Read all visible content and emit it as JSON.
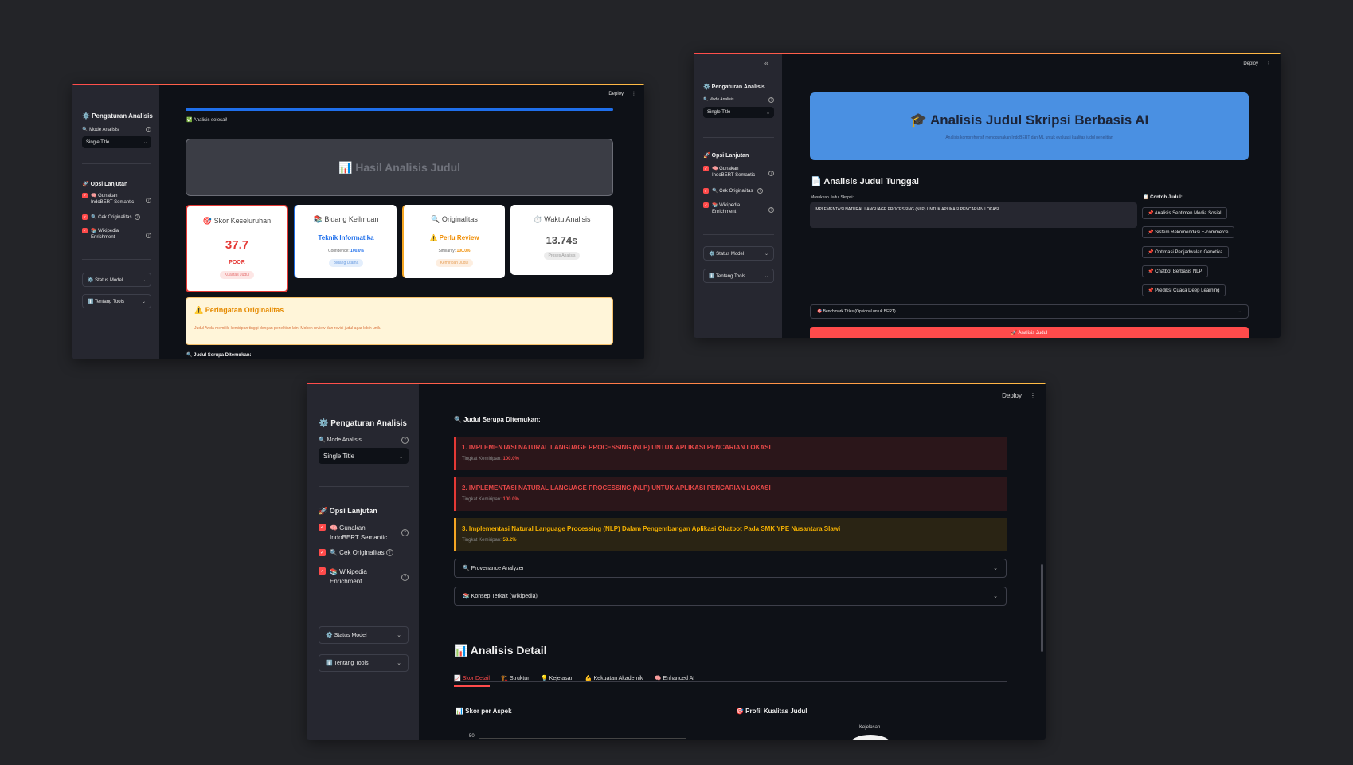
{
  "sidebar": {
    "settings_title": "⚙️ Pengaturan Analisis",
    "mode_label": "🔍 Mode Analisis",
    "mode_value": "Single Title",
    "options_title": "🚀 Opsi Lanjutan",
    "opt_indobert": "🧠 Gunakan IndoBERT Semantic",
    "opt_originality": "🔍 Cek Originalitas",
    "opt_wikipedia": "📚 Wikipedia Enrichment",
    "status_model": "⚙️ Status Model",
    "about_tools": "ℹ️ Tentang Tools",
    "help_symbol": "?"
  },
  "topbar": {
    "deploy": "Deploy",
    "menu": "⋮"
  },
  "window1": {
    "progress": 1.0,
    "done_text": "✅ Analisis selesai!",
    "result_title": "📊 Hasil Analisis Judul",
    "cards": {
      "score": {
        "title": "🎯 Skor Keseluruhan",
        "value": "37.7",
        "grade": "POOR",
        "tag": "Kualitas Judul"
      },
      "field": {
        "title": "📚 Bidang Keilmuan",
        "value": "Teknik Informatika",
        "conf_label": "Confidence:",
        "conf_value": "100.0%",
        "tag": "Bidang Utama"
      },
      "orig": {
        "title": "🔍 Originalitas",
        "value": "⚠️ Perlu Review",
        "sim_label": "Similarity:",
        "sim_value": "100.0%",
        "tag": "Kemiripan Judul"
      },
      "time": {
        "title": "⏱️ Waktu Analisis",
        "value": "13.74s",
        "tag": "Proses Analisis"
      }
    },
    "warning_title": "⚠️ Peringatan Originalitas",
    "warning_text": "Judul Anda memiliki kemiripan tinggi dengan penelitian lain. Mohon review dan revisi judul agar lebih unik.",
    "similar_title": "🔍 Judul Serupa Ditemukan:"
  },
  "window2": {
    "collapse": "«",
    "hero_title": "🎓 Analisis Judul Skripsi Berbasis AI",
    "hero_sub": "Analisis komprehensif menggunakan IndoBERT dan ML untuk evaluasi kualitas judul penelitian",
    "single_title": "📄 Analisis Judul Tunggal",
    "input_label": "Masukkan Judul Skripsi:",
    "input_value": "IMPLEMENTASI NATURAL LANGUAGE PROCESSING (NLP) UNTUK APLIKASI PENCARIAN LOKASI",
    "examples_title": "📋 Contoh Judul:",
    "examples": [
      "📌 Analisis Sentimen Media Sosial",
      "📌 Sistem Rekomendasi E-commerce",
      "📌 Optimasi Penjadwalan Genetika",
      "📌 Chatbot Berbasis NLP",
      "📌 Prediksi Cuaca Deep Learning"
    ],
    "benchmark": "🎯 Benchmark Titles (Opsional untuk BERT)",
    "analyze_button": "🚀 Analisis Judul"
  },
  "window3": {
    "similar_title": "🔍 Judul Serupa Ditemukan:",
    "similar": [
      {
        "title": "1. IMPLEMENTASI NATURAL LANGUAGE PROCESSING (NLP) UNTUK APLIKASI PENCARIAN LOKASI",
        "label": "Tingkat Kemiripan:",
        "value": "100.0%"
      },
      {
        "title": "2. IMPLEMENTASI NATURAL LANGUAGE PROCESSING (NLP) UNTUK APLIKASI PENCARIAN LOKASI",
        "label": "Tingkat Kemiripan:",
        "value": "100.0%"
      },
      {
        "title": "3. Implementasi Natural Language Processing (NLP) Dalam Pengembangan Aplikasi Chatbot Pada SMK YPE Nusantara Slawi",
        "label": "Tingkat Kemiripan:",
        "value": "53.2%"
      }
    ],
    "provenance": "🔍 Provenance Analyzer",
    "concepts": "📚 Konsep Terkait (Wikipedia)",
    "detail_title": "📊 Analisis Detail",
    "tabs": [
      "📈 Skor Detail",
      "🏗️ Struktur",
      "💡 Kejelasan",
      "💪 Kekuatan Akademik",
      "🧠 Enhanced AI"
    ],
    "aspect_title": "📊 Skor per Aspek",
    "profile_title": "🎯 Profil Kualitas Judul",
    "y_tick": "50",
    "radar_label": "Kejelasan"
  },
  "colors": {
    "accent": "#ff4b4b",
    "bg": "#0e1117",
    "sidebar": "#262730",
    "hero": "#4a90e2",
    "danger": "#e53935",
    "warning": "#f5a623"
  }
}
